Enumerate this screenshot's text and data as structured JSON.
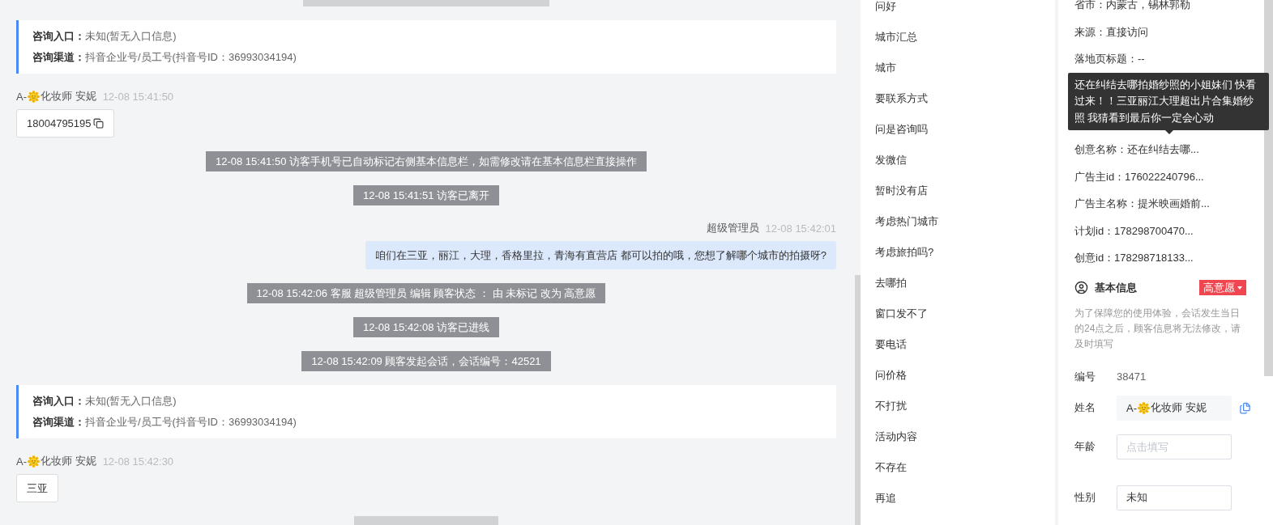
{
  "chat": {
    "items": [
      {
        "kind": "system_partial"
      },
      {
        "kind": "entry_card",
        "rows": [
          {
            "label": "咨询入口：",
            "value": "未知(暂无入口信息)"
          },
          {
            "label": "咨询渠道：",
            "value": "抖音企业号/员工号(抖音号ID：36993034194)"
          }
        ]
      },
      {
        "kind": "customer",
        "sender_prefix": "A-",
        "sender_name": "化妆师 安妮",
        "time": "12-08 15:41:50",
        "text": "18004795195",
        "copyable": true
      },
      {
        "kind": "system",
        "text": "12-08 15:41:50 访客手机号已自动标记右侧基本信息栏，如需修改请在基本信息栏直接操作"
      },
      {
        "kind": "system",
        "text": "12-08 15:41:51 访客已离开"
      },
      {
        "kind": "agent",
        "sender_name": "超级管理员",
        "time": "12-08 15:42:01",
        "text": "咱们在三亚，丽江，大理，香格里拉，青海有直营店 都可以拍的哦，您想了解哪个城市的拍摄呀?"
      },
      {
        "kind": "system",
        "text": "12-08 15:42:06 客服 超级管理员 编辑 顾客状态 ： 由 未标记 改为 高意愿"
      },
      {
        "kind": "system",
        "text": "12-08 15:42:08 访客已进线"
      },
      {
        "kind": "system",
        "text": "12-08 15:42:09 顾客发起会话，会话编号：42521"
      },
      {
        "kind": "entry_card",
        "rows": [
          {
            "label": "咨询入口：",
            "value": "未知(暂无入口信息)"
          },
          {
            "label": "咨询渠道：",
            "value": "抖音企业号/员工号(抖音号ID：36993034194)"
          }
        ]
      },
      {
        "kind": "customer",
        "sender_prefix": "A-",
        "sender_name": "化妆师 安妮",
        "time": "12-08 15:42:30",
        "text": "三亚",
        "copyable": false
      },
      {
        "kind": "system_partial"
      }
    ]
  },
  "quick_replies": [
    "问好",
    "城市汇总",
    "城市",
    "要联系方式",
    "问是咨询吗",
    "发微信",
    "暂时没有店",
    "考虑热门城市",
    "考虑旅拍吗?",
    "去哪拍",
    "窗口发不了",
    "要电话",
    "问价格",
    "不打扰",
    "活动内容",
    "不存在",
    "再追"
  ],
  "source_fields": [
    "省市：内蒙古，锡林郭勒",
    "来源：直接访问",
    "落地页标题：--"
  ],
  "tooltip": "还在纠结去哪拍婚纱照的小姐妹们 快看过来！！三亚丽江大理超出片合集婚纱照 我猜看到最后你一定会心动",
  "source_fields_more": [
    "创意名称：还在纠结去哪...",
    "广告主id：176022240796...",
    "广告主名称：提米映画婚前...",
    "计划id：178298700470...",
    "创意id：178298718133..."
  ],
  "basic_info": {
    "title": "基本信息",
    "intent": "高意愿",
    "note": "为了保障您的使用体验，会话发生当日的24点之后，顾客信息将无法修改，请及时填写",
    "fields": [
      {
        "kind": "static",
        "label": "编号",
        "value": "38471"
      },
      {
        "kind": "readonly",
        "label": "姓名",
        "prefix": "A-",
        "value": "化妆师 安妮",
        "copyable": true
      },
      {
        "kind": "input",
        "label": "年龄",
        "placeholder": "点击填写"
      },
      {
        "kind": "input",
        "label": "性别",
        "value": "未知"
      }
    ]
  }
}
